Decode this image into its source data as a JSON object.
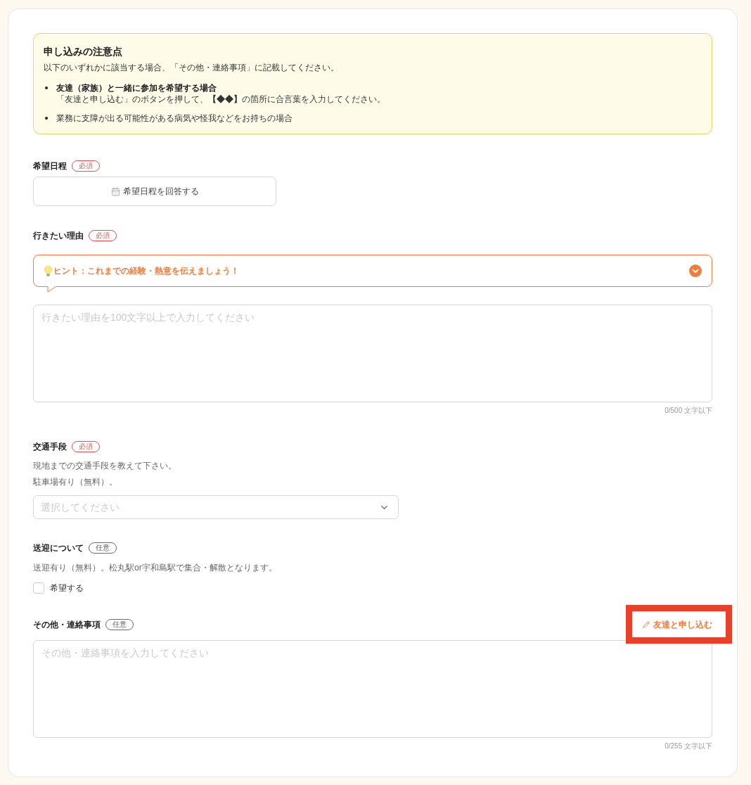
{
  "notice": {
    "title": "申し込みの注意点",
    "intro": "以下のいずれかに該当する場合、「その他・連絡事項」に記載してください。",
    "items": [
      {
        "kind": "heading",
        "title": "友達（家族）と一緒に参加を希望する場合",
        "detail": "「友達と申し込む」のボタンを押して、**【◆◆】**の箇所に合言葉を入力してください。"
      },
      {
        "kind": "plain",
        "text": "業務に支障が出る可能性がある病気や怪我などをお持ちの場合"
      }
    ]
  },
  "fields": [
    {
      "kind": "date_button",
      "label": "希望日程",
      "badge": {
        "kind": "required",
        "text": "必須"
      },
      "button": "希望日程を回答する"
    },
    {
      "kind": "textarea",
      "label": "行きたい理由",
      "badge": {
        "kind": "required",
        "text": "必須"
      },
      "hint": {
        "text": "ヒント：これまでの経験・熱意を伝えましょう！",
        "expanded": false
      },
      "placeholder": "行きたい理由を100文字以上で入力してください",
      "counter": "0/500 文字以下"
    },
    {
      "kind": "select",
      "label": "交通手段",
      "badge": {
        "kind": "required",
        "text": "必須"
      },
      "description": [
        "現地までの交通手段を教えて下さい。",
        "駐車場有り（無料）。"
      ],
      "placeholder": "選択してください"
    },
    {
      "kind": "checkbox",
      "label": "送迎について",
      "badge": {
        "kind": "optional",
        "text": "任意"
      },
      "description": [
        "送迎有り（無料）。松丸駅or宇和島駅で集合・解散となります。"
      ],
      "checkbox": {
        "label": "希望する",
        "checked": false
      }
    },
    {
      "kind": "textarea",
      "label": "その他・連絡事項",
      "badge": {
        "kind": "optional",
        "text": "任意"
      },
      "action": {
        "label": "友達と申し込む",
        "highlighted": true
      },
      "placeholder": "その他・連絡事項を入力してください",
      "counter": "0/255 文字以下"
    }
  ]
}
